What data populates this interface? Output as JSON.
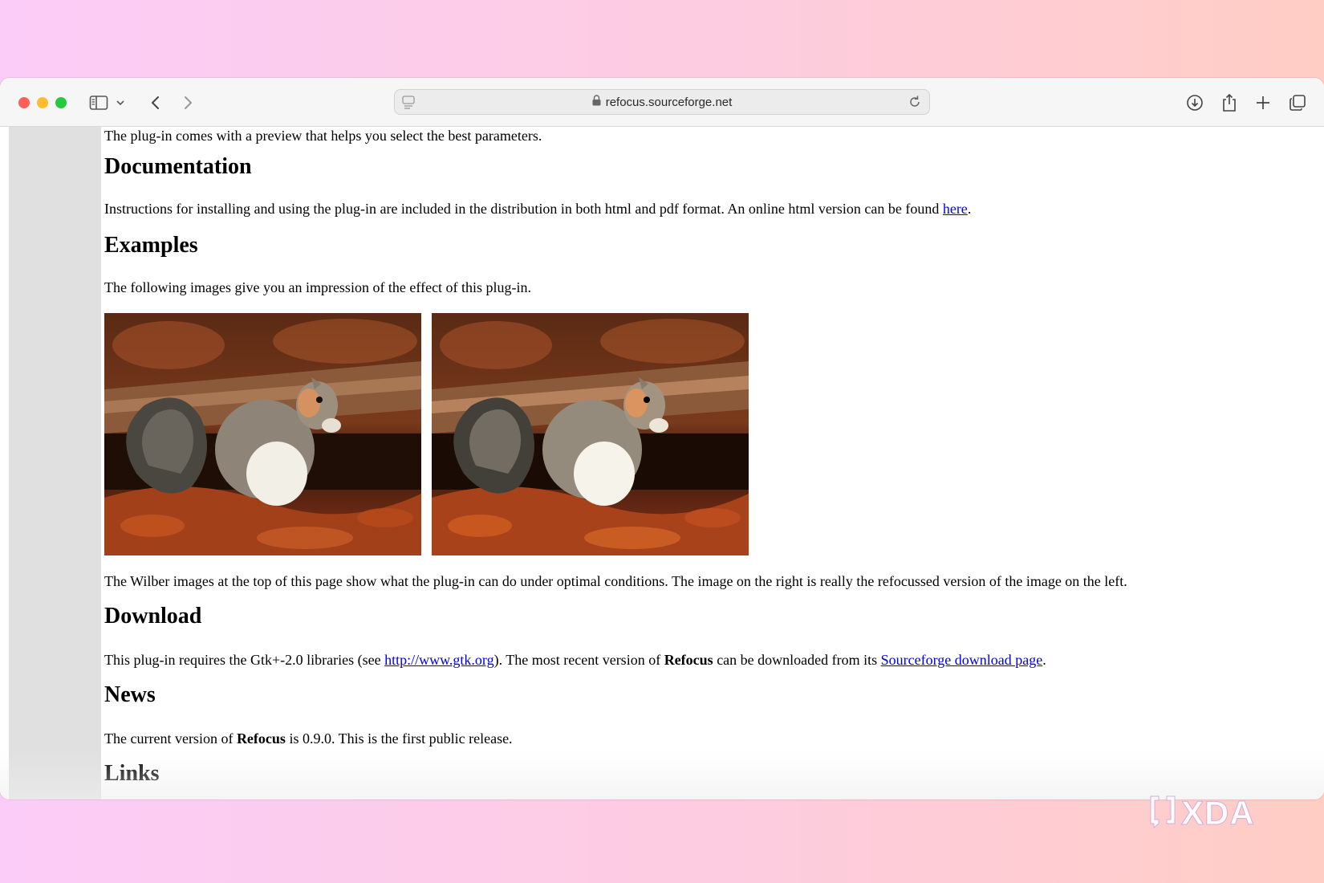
{
  "browser": {
    "url": "refocus.sourceforge.net",
    "icons": [
      "sidebar-icon",
      "chevron-down-icon",
      "back-icon",
      "forward-icon",
      "reader-icon",
      "lock-icon",
      "reload-icon",
      "download-icon",
      "share-icon",
      "new-tab-icon",
      "tab-overview-icon"
    ]
  },
  "page": {
    "intro_tail": "The plug-in comes with a preview that helps you select the best parameters.",
    "documentation": {
      "heading": "Documentation",
      "text_before": "Instructions for installing and using the plug-in are included in the distribution in both html and pdf format. An online html version can be found ",
      "link": "here",
      "text_after": "."
    },
    "examples": {
      "heading": "Examples",
      "text": "The following images give you an impression of the effect of this plug-in.",
      "caption": "The Wilber images at the top of this page show what the plug-in can do under optimal conditions. The image on the right is really the refocussed version of the image on the left."
    },
    "download": {
      "heading": "Download",
      "text_1": "This plug-in requires the Gtk+-2.0 libraries (see ",
      "link_1": "http://www.gtk.org",
      "text_2": "). The most recent version of ",
      "bold": "Refocus",
      "text_3": " can be downloaded from its ",
      "link_2": "Sourceforge download page",
      "text_4": "."
    },
    "news": {
      "heading": "News",
      "text_1": "The current version of ",
      "bold": "Refocus",
      "text_2": " is 0.9.0. This is the first public release."
    },
    "links": {
      "heading": "Links"
    }
  },
  "watermark": {
    "text": "XDA"
  },
  "colors": {
    "link": "#0000ee",
    "background_left": "#fcccf8",
    "background_right": "#ffcdc4"
  }
}
